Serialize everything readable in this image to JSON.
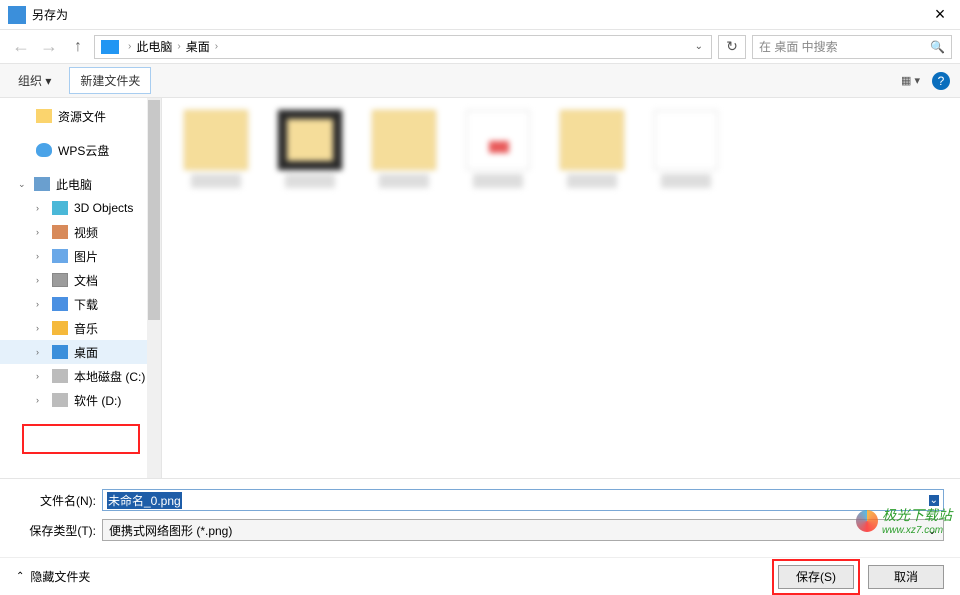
{
  "title": "另存为",
  "nav": {
    "refresh_icon": "↻"
  },
  "breadcrumb": {
    "seg1": "此电脑",
    "seg2": "桌面"
  },
  "search": {
    "placeholder": "在 桌面 中搜索"
  },
  "toolbar": {
    "organize": "组织",
    "new_folder": "新建文件夹",
    "help": "?"
  },
  "tree": {
    "resources": "资源文件",
    "wps": "WPS云盘",
    "pc": "此电脑",
    "items": [
      "3D Objects",
      "视频",
      "图片",
      "文档",
      "下载",
      "音乐",
      "桌面",
      "本地磁盘 (C:)",
      "软件 (D:)"
    ]
  },
  "filename_label": "文件名(N):",
  "filename_value": "未命名_0.png",
  "filetype_label": "保存类型(T):",
  "filetype_value": "便携式网络图形 (*.png)",
  "hide_folders": "隐藏文件夹",
  "save_btn": "保存(S)",
  "cancel_btn": "取消",
  "watermark": {
    "t1": "极光下载站",
    "t2": "www.xz7.com"
  }
}
